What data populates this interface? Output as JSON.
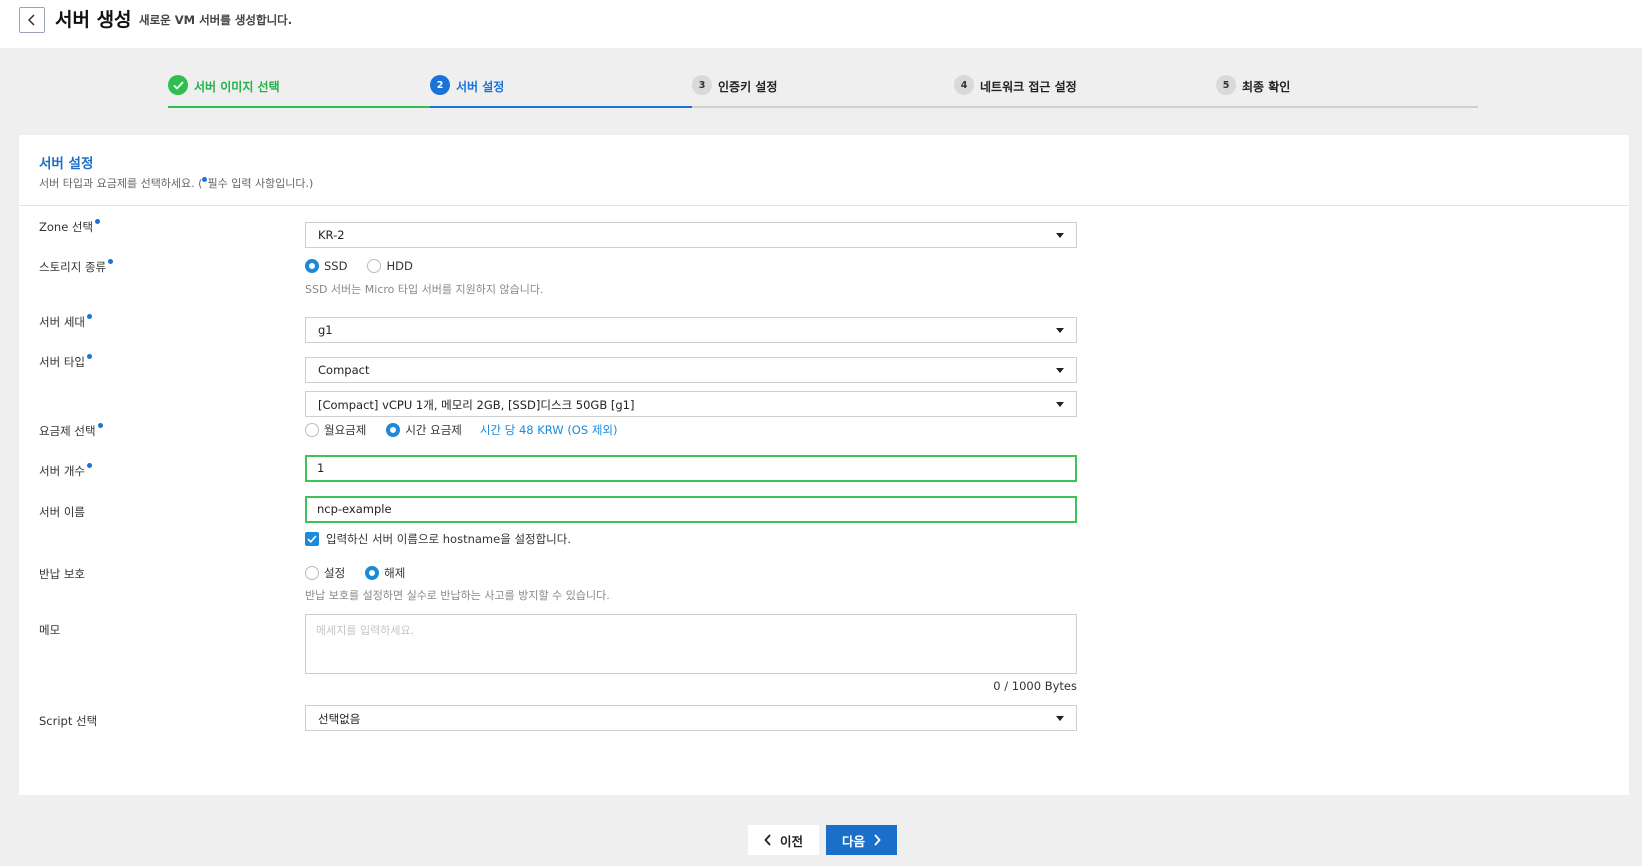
{
  "header": {
    "title": "서버 생성",
    "subtitle": "새로운 VM 서버를 생성합니다."
  },
  "steps": [
    {
      "num": "✓",
      "label": "서버 이미지 선택",
      "state": "done"
    },
    {
      "num": "2",
      "label": "서버 설정",
      "state": "active"
    },
    {
      "num": "3",
      "label": "인증키 설정",
      "state": "pending"
    },
    {
      "num": "4",
      "label": "네트워크 접근 설정",
      "state": "pending"
    },
    {
      "num": "5",
      "label": "최종 확인",
      "state": "pending"
    }
  ],
  "card": {
    "title": "서버 설정",
    "desc_prefix": "서버 타입과 요금제를 선택하세요. (",
    "desc_suffix": "필수 입력 사항입니다.)"
  },
  "form": {
    "zone": {
      "label": "Zone 선택",
      "value": "KR-2"
    },
    "storage": {
      "label": "스토리지 종류",
      "options": [
        "SSD",
        "HDD"
      ],
      "selected": "SSD",
      "hint": "SSD 서버는 Micro 타입 서버를 지원하지 않습니다."
    },
    "generation": {
      "label": "서버 세대",
      "value": "g1"
    },
    "server_type": {
      "label": "서버 타입",
      "value": "Compact",
      "spec": "[Compact] vCPU 1개, 메모리 2GB, [SSD]디스크 50GB [g1]"
    },
    "pricing": {
      "label": "요금제 선택",
      "options": [
        "월요금제",
        "시간 요금제"
      ],
      "selected": "시간 요금제",
      "price_note": "시간 당 48 KRW (OS 제외)"
    },
    "count": {
      "label": "서버 개수",
      "value": "1"
    },
    "name": {
      "label": "서버 이름",
      "value": "ncp-example",
      "checkbox_label": "입력하신 서버 이름으로 hostname을 설정합니다.",
      "checked": true
    },
    "return_protection": {
      "label": "반납 보호",
      "options": [
        "설정",
        "해제"
      ],
      "selected": "해제",
      "hint": "반납 보호를 설정하면 실수로 반납하는 사고를 방지할 수 있습니다."
    },
    "memo": {
      "label": "메모",
      "placeholder": "메세지를 입력하세요.",
      "counter": "0 / 1000 Bytes"
    },
    "script": {
      "label": "Script 선택",
      "value": "선택없음"
    }
  },
  "footer": {
    "prev_label": "이전",
    "next_label": "다음"
  },
  "colors": {
    "accent": "#1a73d9",
    "done": "#2fbf4f",
    "radio": "#1a8ad9"
  }
}
